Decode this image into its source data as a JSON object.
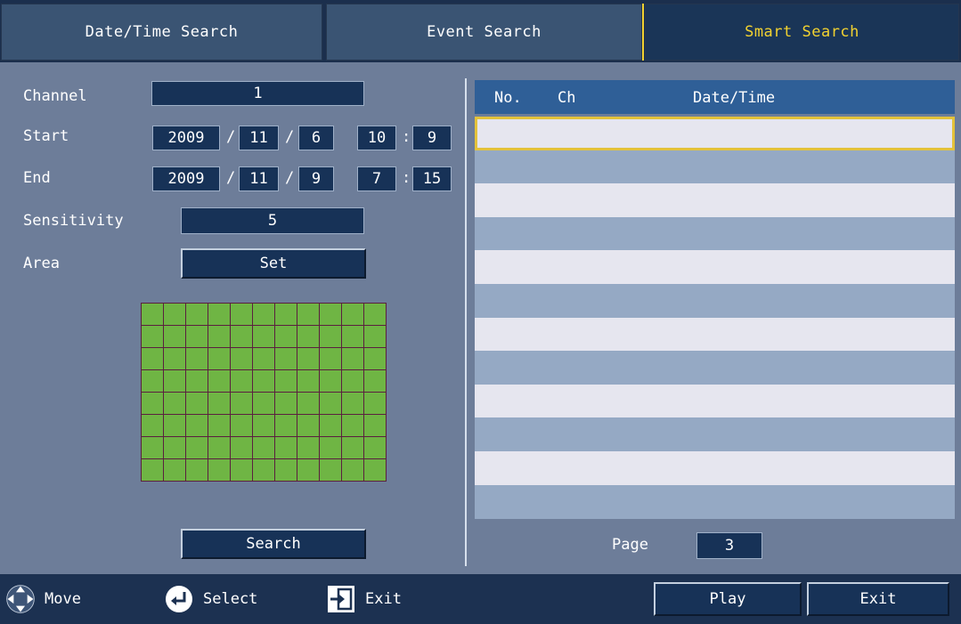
{
  "tabs": [
    {
      "label": "Date/Time Search",
      "active": false
    },
    {
      "label": "Event Search",
      "active": false
    },
    {
      "label": "Smart Search",
      "active": true
    }
  ],
  "form": {
    "channel_label": "Channel",
    "channel_value": "1",
    "start_label": "Start",
    "start": {
      "year": "2009",
      "month": "11",
      "day": "6",
      "hour": "10",
      "minute": "9"
    },
    "end_label": "End",
    "end": {
      "year": "2009",
      "month": "11",
      "day": "9",
      "hour": "7",
      "minute": "15"
    },
    "date_sep": "/",
    "time_sep": ":",
    "sensitivity_label": "Sensitivity",
    "sensitivity_value": "5",
    "area_label": "Area",
    "area_button": "Set",
    "search_button": "Search"
  },
  "area_grid": {
    "columns": 11,
    "rows": 8,
    "selected_color": "#6fb544",
    "line_color": "#5b1f3f"
  },
  "results": {
    "columns": [
      "No.",
      "Ch",
      "Date/Time"
    ],
    "rows": 12,
    "page_label": "Page",
    "page_value": "3"
  },
  "footer": {
    "move_label": "Move",
    "select_label": "Select",
    "exit_hint_label": "Exit",
    "play_button": "Play",
    "exit_button": "Exit"
  },
  "colors": {
    "accent": "#f2d230",
    "panel": "#6d7d99",
    "field": "#173257"
  }
}
